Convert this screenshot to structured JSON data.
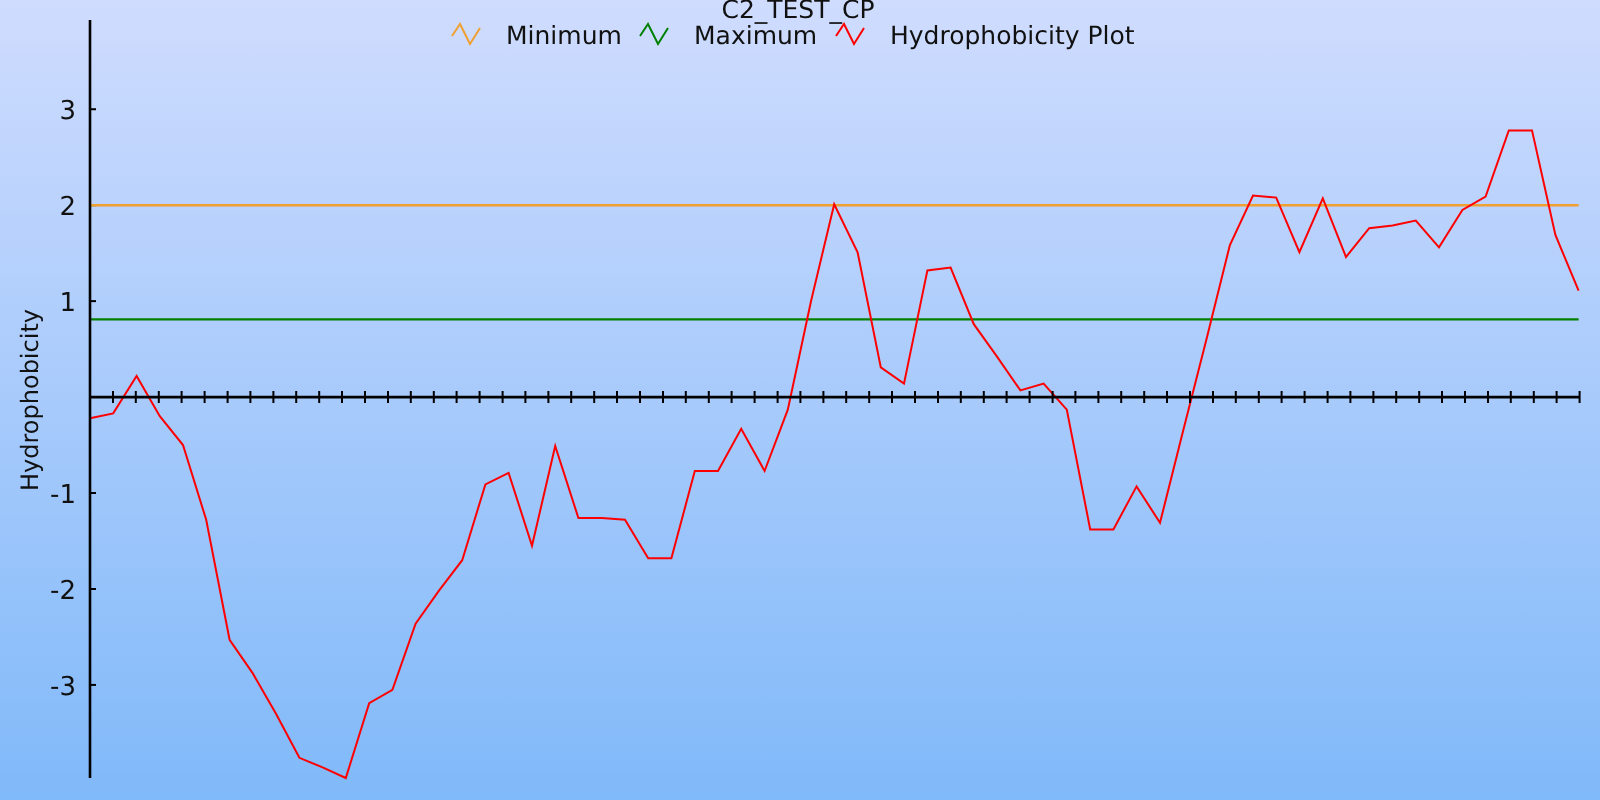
{
  "chart_data": {
    "type": "line",
    "title": "C2_TEST_CP",
    "ylabel": "Hydrophobicity",
    "ylim": [
      -3.97,
      3.93
    ],
    "legend": true,
    "yticks": [
      -3,
      -2,
      -1,
      1,
      2,
      3
    ],
    "series": [
      {
        "name": "Minimum",
        "color": "#f0a030",
        "values": [
          2,
          2,
          2,
          2,
          2,
          2,
          2,
          2,
          2,
          2,
          2,
          2,
          2,
          2,
          2,
          2,
          2,
          2,
          2,
          2,
          2,
          2,
          2,
          2,
          2,
          2,
          2,
          2,
          2,
          2,
          2,
          2,
          2,
          2,
          2,
          2,
          2,
          2,
          2,
          2,
          2,
          2,
          2,
          2,
          2,
          2,
          2,
          2,
          2,
          2,
          2,
          2,
          2,
          2,
          2,
          2,
          2,
          2,
          2,
          2,
          2,
          2,
          2,
          2,
          2
        ]
      },
      {
        "name": "Maximum",
        "color": "#008000",
        "values": [
          0.81,
          0.81,
          0.81,
          0.81,
          0.81,
          0.81,
          0.81,
          0.81,
          0.81,
          0.81,
          0.81,
          0.81,
          0.81,
          0.81,
          0.81,
          0.81,
          0.81,
          0.81,
          0.81,
          0.81,
          0.81,
          0.81,
          0.81,
          0.81,
          0.81,
          0.81,
          0.81,
          0.81,
          0.81,
          0.81,
          0.81,
          0.81,
          0.81,
          0.81,
          0.81,
          0.81,
          0.81,
          0.81,
          0.81,
          0.81,
          0.81,
          0.81,
          0.81,
          0.81,
          0.81,
          0.81,
          0.81,
          0.81,
          0.81,
          0.81,
          0.81,
          0.81,
          0.81,
          0.81,
          0.81,
          0.81,
          0.81,
          0.81,
          0.81,
          0.81,
          0.81,
          0.81,
          0.81,
          0.81,
          0.81
        ]
      },
      {
        "name": "Hydrophobicity Plot",
        "color": "#ff0000",
        "values": [
          -0.22,
          -0.17,
          0.22,
          -0.2,
          -0.5,
          -1.28,
          -2.53,
          -2.88,
          -3.3,
          -3.76,
          -3.86,
          -3.97,
          -3.19,
          -3.05,
          -2.36,
          -2.02,
          -1.7,
          -0.91,
          -0.79,
          -1.55,
          -0.51,
          -1.26,
          -1.26,
          -1.28,
          -1.68,
          -1.68,
          -0.77,
          -0.77,
          -0.33,
          -0.77,
          -0.13,
          1.0,
          2.01,
          1.51,
          0.31,
          0.14,
          1.32,
          1.35,
          0.76,
          0.42,
          0.07,
          0.14,
          -0.13,
          -1.38,
          -1.38,
          -0.93,
          -1.31,
          -0.35,
          0.6,
          1.58,
          2.1,
          2.08,
          1.51,
          2.07,
          1.46,
          1.76,
          1.79,
          1.84,
          1.56,
          1.95,
          2.09,
          2.78,
          2.78,
          1.69,
          1.11
        ]
      }
    ]
  }
}
